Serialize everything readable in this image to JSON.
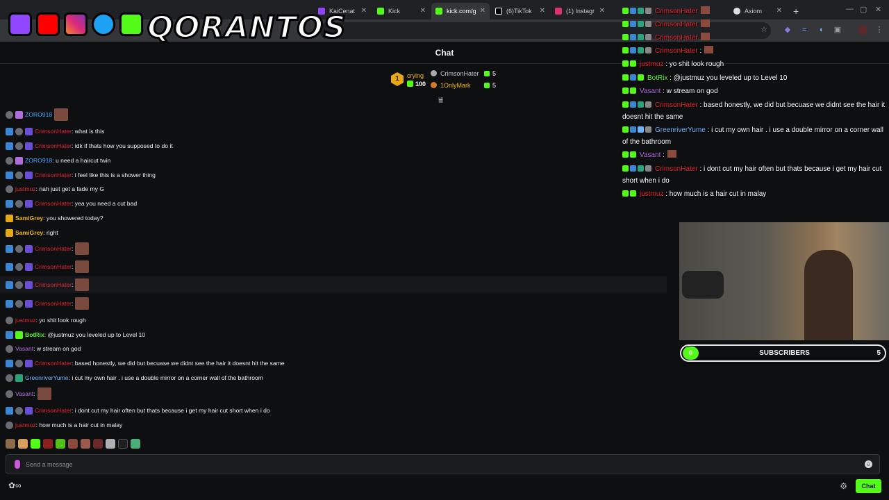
{
  "browser": {
    "tabs": [
      {
        "title": "KaiCenat",
        "color": "#9146ff"
      },
      {
        "title": "Kick",
        "color": "#53fc18"
      },
      {
        "title": "kick.com/g",
        "color": "#53fc18"
      },
      {
        "title": "(6)TikTok",
        "color": "#ffffff"
      },
      {
        "title": "(1) Instagr",
        "color": "#e1306c"
      },
      {
        "title": "Axiom",
        "color": "#dddddd"
      }
    ],
    "new_tab": "+"
  },
  "logo": {
    "text": "QORANTOS"
  },
  "chat": {
    "header": "Chat",
    "leaderboard": {
      "rank": "1",
      "first_name": "crying",
      "first_count": "100",
      "second_name": "CrimsonHater",
      "second_count": "5",
      "third_name": "1OnlyMark",
      "third_count": "5"
    },
    "messages": [
      {
        "user": "ZORO918",
        "color": "#4aa3ff",
        "text": ""
      },
      {
        "user": "CrimsonHater",
        "color": "#e8252f",
        "text": ": what is this"
      },
      {
        "user": "CrimsonHater",
        "color": "#e8252f",
        "text": ": idk if thats how you supposed to do it"
      },
      {
        "user": "ZORO918",
        "color": "#4aa3ff",
        "text": ": u need a haircut twin"
      },
      {
        "user": "CrimsonHater",
        "color": "#e8252f",
        "text": ": i feel like this is a shower thing"
      },
      {
        "user": "justmuz",
        "color": "#e8252f",
        "text": ": nah just get a fade my G"
      },
      {
        "user": "CrimsonHater",
        "color": "#e8252f",
        "text": ": yea you need a cut bad"
      },
      {
        "user": "SamiGrey",
        "color": "#f2b90f",
        "text": ": you showered today?"
      },
      {
        "user": "SamiGrey",
        "color": "#f2b90f",
        "text": ": right"
      },
      {
        "user": "CrimsonHater",
        "color": "#e8252f",
        "text": ":"
      },
      {
        "user": "CrimsonHater",
        "color": "#e8252f",
        "text": ":"
      },
      {
        "user": "CrimsonHater",
        "color": "#e8252f",
        "text": ":"
      },
      {
        "user": "CrimsonHater",
        "color": "#e8252f",
        "text": ":"
      },
      {
        "user": "justmuz",
        "color": "#e8252f",
        "text": ": yo shit look rough"
      },
      {
        "user": "BotRix",
        "color": "#53fc18",
        "text": ": @justmuz you leveled up to Level 10"
      },
      {
        "user": "Vasant",
        "color": "#b06de0",
        "text": ": w stream on god"
      },
      {
        "user": "CrimsonHater",
        "color": "#e8252f",
        "text": ": based honestly, we did but becuase we didnt see the hair it doesnt hit the same"
      },
      {
        "user": "GreenriverYume",
        "color": "#6fb3ff",
        "text": ": i cut my own hair . i use a double mirror on a corner wall of the bathroom"
      },
      {
        "user": "Vasant",
        "color": "#b06de0",
        "text": ":"
      },
      {
        "user": "CrimsonHater",
        "color": "#e8252f",
        "text": ": i dont cut my hair often but thats because i get my hair cut short when i do"
      },
      {
        "user": "justmuz",
        "color": "#e8252f",
        "text": ": how much is a hair cut in malay"
      }
    ],
    "input_placeholder": "Send a message",
    "chat_button": "Chat"
  },
  "overlay": {
    "messages": [
      {
        "user": "CrimsonHater",
        "color": "#e8252f",
        "text": ""
      },
      {
        "user": "CrimsonHater",
        "color": "#e8252f",
        "text": ""
      },
      {
        "user": "CrimsonHater",
        "color": "#e8252f",
        "text": ""
      },
      {
        "user": "CrimsonHater",
        "color": "#e8252f",
        "text": " :"
      },
      {
        "user": "justmuz",
        "color": "#e8252f",
        "text": " : yo shit look rough"
      },
      {
        "user": "BotRix",
        "color": "#53fc18",
        "text": " : @justmuz you leveled up to Level 10"
      },
      {
        "user": "Vasant",
        "color": "#b06de0",
        "text": " : w stream on god"
      },
      {
        "user": "CrimsonHater",
        "color": "#e8252f",
        "text": " : based honestly, we did but becuase we didnt see the hair it doesnt hit the same"
      },
      {
        "user": "GreenriverYume",
        "color": "#6fb3ff",
        "text": " : i cut my own hair . i use a double mirror on a corner wall of the bathroom"
      },
      {
        "user": "Vasant",
        "color": "#b06de0",
        "text": " :"
      },
      {
        "user": "CrimsonHater",
        "color": "#e8252f",
        "text": " : i dont cut my hair often but thats because i get my hair cut short when i do"
      },
      {
        "user": "justmuz",
        "color": "#e8252f",
        "text": " : how much is a hair cut in malay"
      }
    ]
  },
  "subscribers": {
    "current": "0",
    "label": "SUBSCRIBERS",
    "goal": "5",
    "progress": 0
  }
}
